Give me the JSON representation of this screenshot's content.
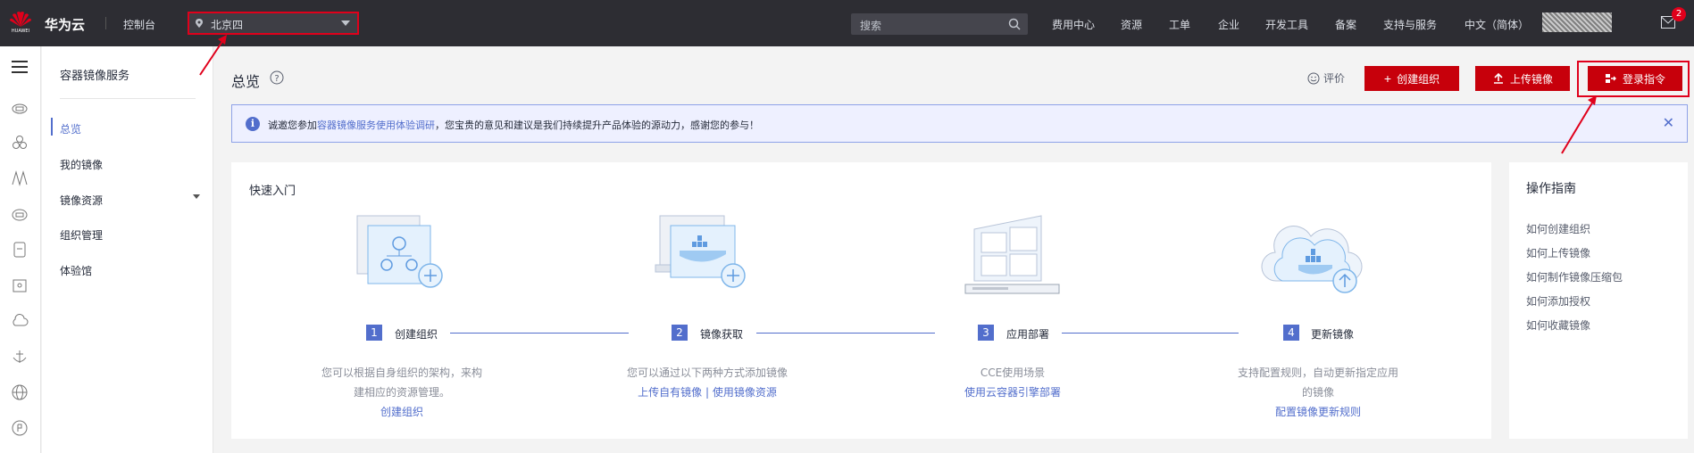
{
  "topbar": {
    "logo_text": "HUAWEI",
    "brand": "华为云",
    "console": "控制台",
    "region": "北京四",
    "search_placeholder": "搜索",
    "nav": [
      "费用中心",
      "资源",
      "工单",
      "企业",
      "开发工具",
      "备案",
      "支持与服务",
      "中文（简体）"
    ],
    "mail_badge": "2"
  },
  "sidebar": {
    "title": "容器镜像服务",
    "items": [
      {
        "label": "总览",
        "active": true
      },
      {
        "label": "我的镜像"
      },
      {
        "label": "镜像资源",
        "has_submenu": true
      },
      {
        "label": "组织管理"
      },
      {
        "label": "体验馆"
      }
    ]
  },
  "page": {
    "title": "总览",
    "rate_label": "评价",
    "buttons": {
      "create_org": "创建组织",
      "upload_image": "上传镜像",
      "login_cmd": "登录指令"
    }
  },
  "notice": {
    "prefix": "诚邀您参加",
    "link": "容器镜像服务使用体验调研",
    "suffix": "，您宝贵的意见和建议是我们持续提升产品体验的源动力，感谢您的参与！"
  },
  "quick_start": {
    "title": "快速入门",
    "steps": [
      {
        "num": "1",
        "name": "创建组织",
        "desc": "您可以根据自身组织的架构，来构建相应的资源管理。",
        "links": "创建组织"
      },
      {
        "num": "2",
        "name": "镜像获取",
        "desc": "您可以通过以下两种方式添加镜像",
        "links": "上传自有镜像 | 使用镜像资源"
      },
      {
        "num": "3",
        "name": "应用部署",
        "desc": "CCE使用场景",
        "links": "使用云容器引擎部署"
      },
      {
        "num": "4",
        "name": "更新镜像",
        "desc": "支持配置规则，自动更新指定应用的镜像",
        "links": "配置镜像更新规则"
      }
    ]
  },
  "guide": {
    "title": "操作指南",
    "links": [
      "如何创建组织",
      "如何上传镜像",
      "如何制作镜像压缩包",
      "如何添加授权",
      "如何收藏镜像"
    ]
  },
  "colors": {
    "accent": "#526ecc",
    "brand_red": "#c7000b",
    "topbar": "#2d2d33"
  }
}
